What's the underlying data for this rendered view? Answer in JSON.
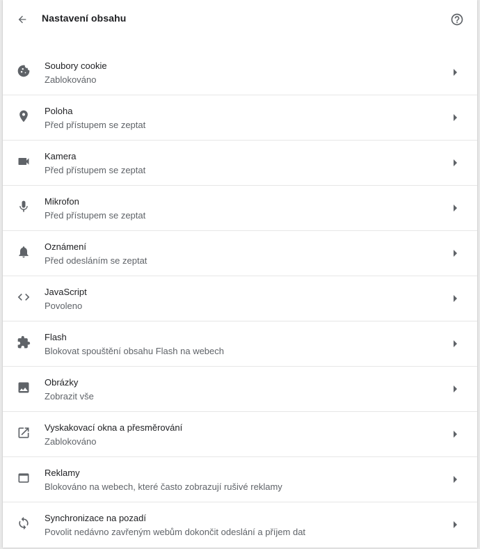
{
  "header": {
    "title": "Nastavení obsahu",
    "back_icon": "arrow-back-icon",
    "help_icon": "help-icon"
  },
  "colors": {
    "icon": "#5f6368",
    "title": "#202124",
    "subtitle": "#5f6368",
    "divider": "#e6e6e6"
  },
  "settings": [
    {
      "icon": "cookie-icon",
      "title": "Soubory cookie",
      "subtitle": "Zablokováno"
    },
    {
      "icon": "location-pin-icon",
      "title": "Poloha",
      "subtitle": "Před přístupem se zeptat"
    },
    {
      "icon": "videocam-icon",
      "title": "Kamera",
      "subtitle": "Před přístupem se zeptat"
    },
    {
      "icon": "microphone-icon",
      "title": "Mikrofon",
      "subtitle": "Před přístupem se zeptat"
    },
    {
      "icon": "bell-icon",
      "title": "Oznámení",
      "subtitle": "Před odesláním se zeptat"
    },
    {
      "icon": "code-brackets-icon",
      "title": "JavaScript",
      "subtitle": "Povoleno"
    },
    {
      "icon": "puzzle-piece-icon",
      "title": "Flash",
      "subtitle": "Blokovat spouštění obsahu Flash na webech"
    },
    {
      "icon": "image-icon",
      "title": "Obrázky",
      "subtitle": "Zobrazit vše"
    },
    {
      "icon": "open-in-new-icon",
      "title": "Vyskakovací okna a přesměrování",
      "subtitle": "Zablokováno"
    },
    {
      "icon": "web-window-icon",
      "title": "Reklamy",
      "subtitle": "Blokováno na webech, které často zobrazují rušivé reklamy"
    },
    {
      "icon": "sync-icon",
      "title": "Synchronizace na pozadí",
      "subtitle": "Povolit nedávno zavřeným webům dokončit odeslání a příjem dat"
    }
  ]
}
